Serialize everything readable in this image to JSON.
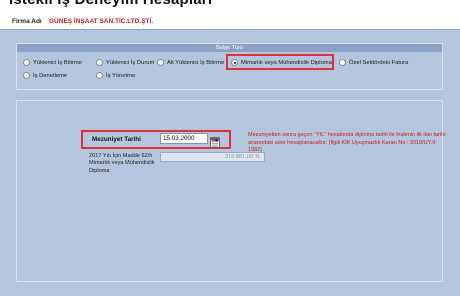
{
  "window": {
    "title": "İstekli İş Deneyim Hesapları"
  },
  "firm": {
    "label": "Firma Adı",
    "value": "GÜNEŞ İNŞAAT SAN.TİC.LTD.ŞTİ."
  },
  "document_type": {
    "header": "Belge Türü",
    "options": [
      {
        "label": "Yüklenici İş Bitirme",
        "selected": false
      },
      {
        "label": "Yüklenici İş Durum",
        "selected": false
      },
      {
        "label": "Alt Yüklenici İş Bitirme",
        "selected": false
      },
      {
        "label": "Mimarlık veya Mühendislik Diploma",
        "selected": true
      },
      {
        "label": "Özel Sektördeki Fatura",
        "selected": false
      },
      {
        "label": "İş Denetleme",
        "selected": false
      },
      {
        "label": "İş Yönetme",
        "selected": false
      }
    ]
  },
  "graduation": {
    "label": "Mezuniyet Tarihi",
    "value": "15.03.2000",
    "madde_label": "2017 Yılı İçin Madde 62/h Mimarlık veya Mühendislik Diploma",
    "amount": "216.881,00 TL",
    "info": "Mezuniyetten sonra geçen \"YIL\" hesabında diploma tarihi ile ihalenin ilk ilan tarihi arasındaki süre hesaplanacaktır. (İlgili KİK Uyuşmazlık Kararı No : 2010/UY.II-1982)"
  },
  "colors": {
    "panel": "#b4c6de",
    "highlight": "#e0303a",
    "firm_text": "#cc1a1a",
    "info_text": "#cc1a1a"
  },
  "icons": {
    "calendar": "calendar-icon"
  }
}
